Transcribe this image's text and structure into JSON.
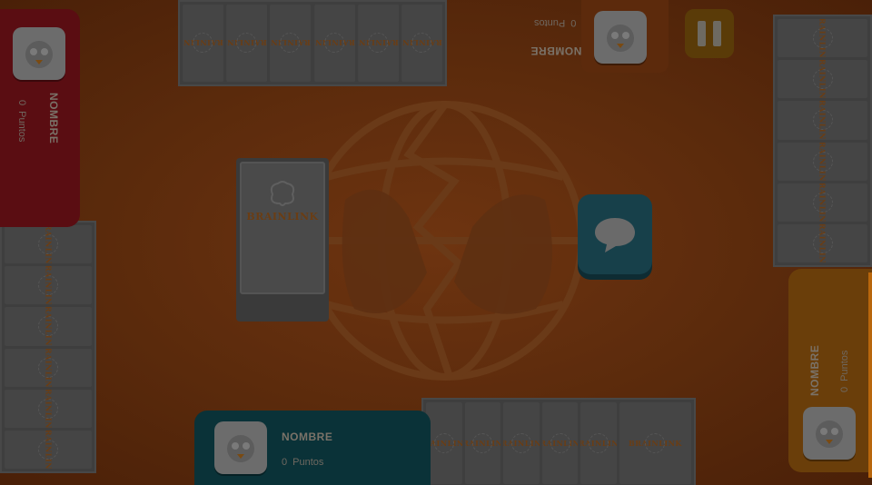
{
  "game": {
    "deck_logo": "BRAINLINK",
    "card_back_label": "BRAINLINK"
  },
  "players": {
    "left": {
      "name": "NOMBRE",
      "score": "0",
      "score_label": "Puntos",
      "color": "#5a0d12"
    },
    "top": {
      "name": "NOMBRE",
      "score": "0",
      "score_label": "Puntos",
      "color": "#5c2a0c"
    },
    "right": {
      "name": "NOMBRE",
      "score": "0",
      "score_label": "Puntos",
      "color": "#6a3e0a"
    },
    "bottom": {
      "name": "NOMBRE",
      "score": "0",
      "score_label": "Puntos",
      "color": "#0a3238"
    }
  },
  "hands": {
    "top_count": 6,
    "left_count": 6,
    "right_count": 6,
    "bottom_count": 6
  },
  "buttons": {
    "chat_icon": "speech-bubble-icon",
    "pause_icon": "pause-icon"
  },
  "colors": {
    "table": "#5a2a0c",
    "chat": "#17404a",
    "pause": "#5a3b08",
    "accent": "#b8660c"
  }
}
